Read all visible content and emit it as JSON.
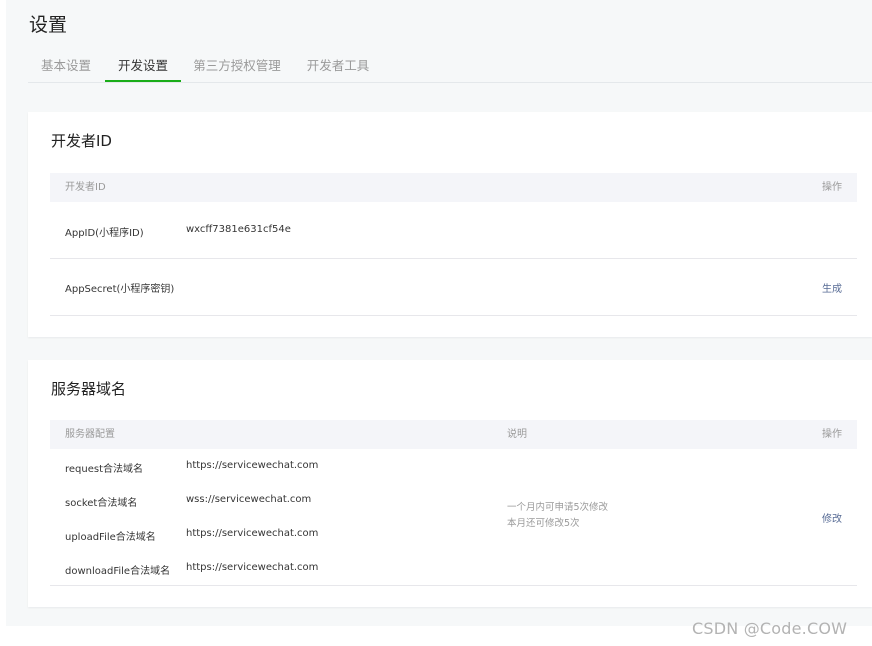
{
  "page": {
    "title": "设置"
  },
  "tabs": [
    {
      "label": "基本设置",
      "active": false
    },
    {
      "label": "开发设置",
      "active": true
    },
    {
      "label": "第三方授权管理",
      "active": false
    },
    {
      "label": "开发者工具",
      "active": false
    }
  ],
  "developer_id": {
    "title": "开发者ID",
    "header": {
      "name": "开发者ID",
      "action": "操作"
    },
    "rows": [
      {
        "label": "AppID(小程序ID)",
        "value": "wxcff7381e631cf54e",
        "action": ""
      },
      {
        "label": "AppSecret(小程序密钥)",
        "value": "",
        "action": "生成"
      }
    ]
  },
  "server_domain": {
    "title": "服务器域名",
    "header": {
      "config": "服务器配置",
      "desc": "说明",
      "action": "操作"
    },
    "rows": [
      {
        "label": "request合法域名",
        "value": "https://servicewechat.com"
      },
      {
        "label": "socket合法域名",
        "value": "wss://servicewechat.com"
      },
      {
        "label": "uploadFile合法域名",
        "value": "https://servicewechat.com"
      },
      {
        "label": "downloadFile合法域名",
        "value": "https://servicewechat.com"
      }
    ],
    "desc_lines": [
      "一个月内可申请5次修改",
      "本月还可修改5次"
    ],
    "action": "修改"
  },
  "watermark": "CSDN @Code.COW",
  "colors": {
    "accent": "#1aad19",
    "link": "#576b95",
    "header_bg": "#f4f5f9"
  }
}
